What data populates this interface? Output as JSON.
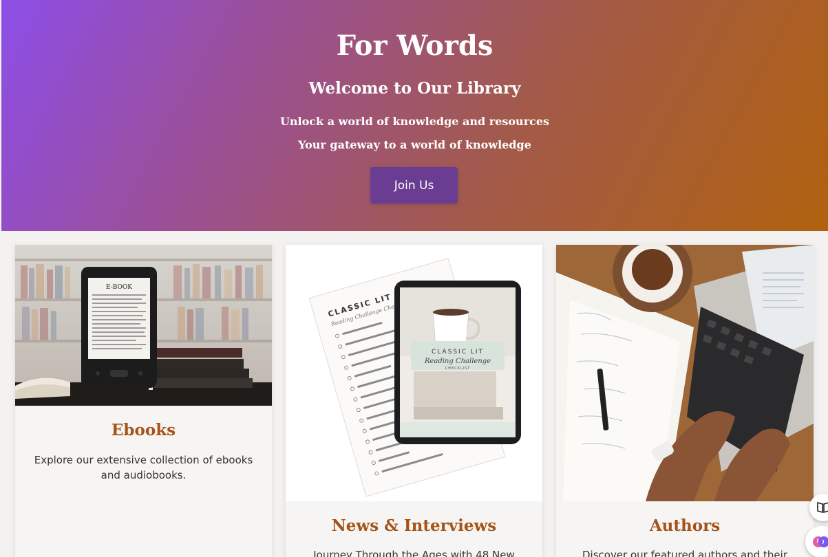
{
  "hero": {
    "site_title": "For Words",
    "welcome": "Welcome to Our Library",
    "tagline1": "Unlock a world of knowledge and resources",
    "tagline2": "Your gateway to a world of knowledge",
    "join_label": "Join Us"
  },
  "cards": [
    {
      "title": "Ebooks",
      "description": "Explore our extensive collection of ebooks and audiobooks.",
      "image_text": "E-BOOK"
    },
    {
      "title": "News & Interviews",
      "description": "Journey Through the Ages with 48 New",
      "image_text_1": "CLASSIC LIT",
      "image_text_2": "Reading Challenge Checklist",
      "image_text_3": "Reading Challenge",
      "image_text_4": "CHECKLIST"
    },
    {
      "title": "Authors",
      "description": "Discover our featured authors and their"
    }
  ],
  "icons": {
    "reader": "book-open-icon",
    "assistant": "brain-icon"
  },
  "colors": {
    "accent": "#6a3d93",
    "heading": "#a3541a",
    "gradient_start": "#8d4ee8",
    "gradient_end": "#b0620e"
  }
}
